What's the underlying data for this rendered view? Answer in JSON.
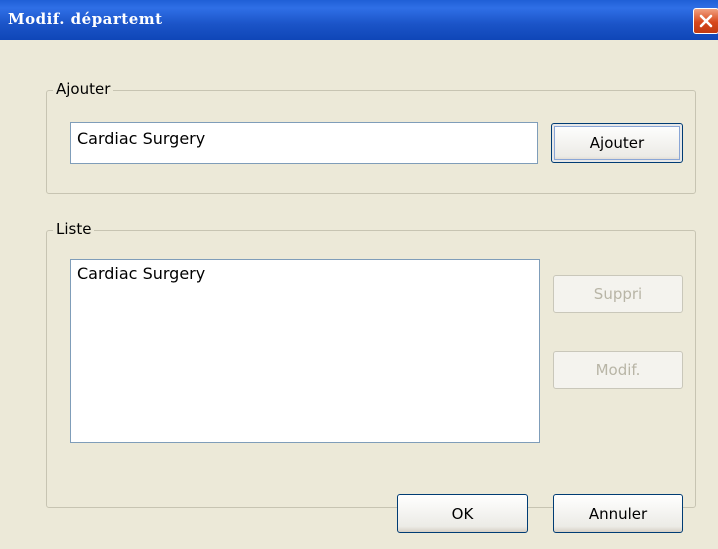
{
  "window": {
    "title": "Modif. départemt"
  },
  "add_group": {
    "label": "Ajouter",
    "input_value": "Cardiac Surgery",
    "add_button": "Ajouter"
  },
  "list_group": {
    "label": "Liste",
    "items": [
      "Cardiac Surgery"
    ],
    "delete_button": "Suppri",
    "modify_button": "Modif."
  },
  "footer": {
    "ok_button": "OK",
    "cancel_button": "Annuler"
  },
  "colors": {
    "titlebar": "#1b54c8",
    "dialog_bg": "#ece9d8",
    "close": "#d8481c"
  }
}
